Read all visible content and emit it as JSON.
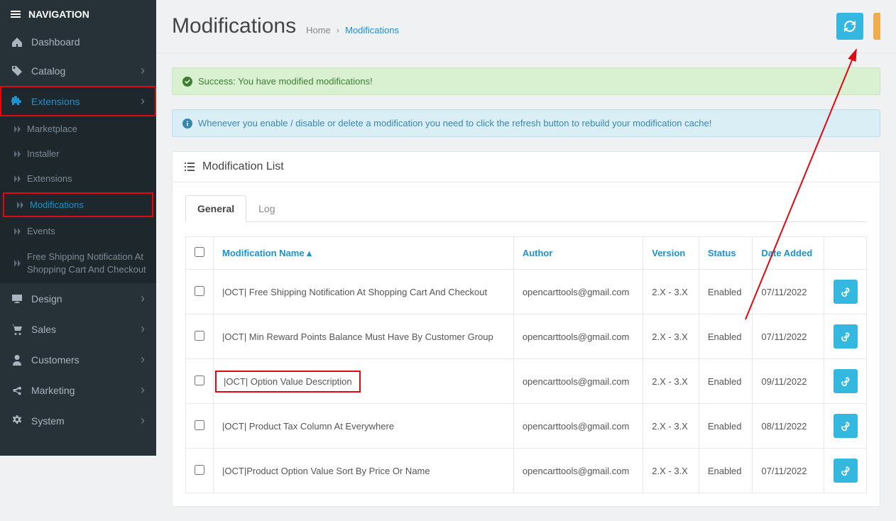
{
  "nav": {
    "header": "NAVIGATION",
    "items": [
      {
        "key": "dashboard",
        "label": "Dashboard",
        "icon": "dashboard",
        "expand": false
      },
      {
        "key": "catalog",
        "label": "Catalog",
        "icon": "tag",
        "expand": true
      },
      {
        "key": "extensions",
        "label": "Extensions",
        "icon": "puzzle",
        "expand": true,
        "active": true,
        "highlight": true,
        "children": [
          {
            "key": "marketplace",
            "label": "Marketplace"
          },
          {
            "key": "installer",
            "label": "Installer"
          },
          {
            "key": "extensions-sub",
            "label": "Extensions"
          },
          {
            "key": "modifications",
            "label": "Modifications",
            "active": true,
            "highlight": true
          },
          {
            "key": "events",
            "label": "Events"
          },
          {
            "key": "free-ship",
            "label": "Free Shipping Notification At Shopping Cart And Checkout",
            "long": true
          }
        ]
      },
      {
        "key": "design",
        "label": "Design",
        "icon": "monitor",
        "expand": true
      },
      {
        "key": "sales",
        "label": "Sales",
        "icon": "cart",
        "expand": true
      },
      {
        "key": "customers",
        "label": "Customers",
        "icon": "user",
        "expand": true
      },
      {
        "key": "marketing",
        "label": "Marketing",
        "icon": "share",
        "expand": true
      },
      {
        "key": "system",
        "label": "System",
        "icon": "gear",
        "expand": true
      }
    ]
  },
  "header": {
    "title": "Modifications",
    "crumb_home": "Home",
    "crumb_sep": "›",
    "crumb_current": "Modifications"
  },
  "alerts": {
    "success": "Success: You have modified modifications!",
    "info": "Whenever you enable / disable or delete a modification you need to click the refresh button to rebuild your modification cache!"
  },
  "panel": {
    "title": "Modification List",
    "tabs": {
      "general": "General",
      "log": "Log"
    }
  },
  "table": {
    "cols": {
      "name": "Modification Name",
      "author": "Author",
      "version": "Version",
      "status": "Status",
      "date": "Date Added"
    },
    "rows": [
      {
        "name": "|OCT| Free Shipping Notification At Shopping Cart And Checkout",
        "author": "opencarttools@gmail.com",
        "version": "2.X - 3.X",
        "status": "Enabled",
        "date": "07/11/2022"
      },
      {
        "name": "|OCT| Min Reward Points Balance Must Have By Customer Group",
        "author": "opencarttools@gmail.com",
        "version": "2.X - 3.X",
        "status": "Enabled",
        "date": "07/11/2022"
      },
      {
        "name": "|OCT| Option Value Description",
        "author": "opencarttools@gmail.com",
        "version": "2.X - 3.X",
        "status": "Enabled",
        "date": "09/11/2022",
        "highlight": true
      },
      {
        "name": "|OCT| Product Tax Column At Everywhere",
        "author": "opencarttools@gmail.com",
        "version": "2.X - 3.X",
        "status": "Enabled",
        "date": "08/11/2022"
      },
      {
        "name": "|OCT|Product Option Value Sort By Price Or Name",
        "author": "opencarttools@gmail.com",
        "version": "2.X - 3.X",
        "status": "Enabled",
        "date": "07/11/2022"
      }
    ]
  }
}
